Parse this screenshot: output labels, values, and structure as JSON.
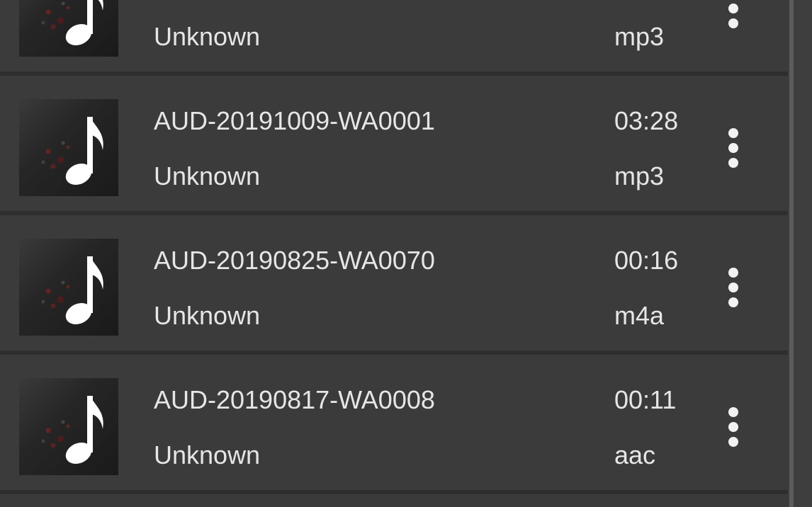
{
  "songs": [
    {
      "title": "",
      "artist": "Unknown",
      "duration": "",
      "format": "mp3",
      "icon": "music-note-icon"
    },
    {
      "title": "AUD-20191009-WA0001",
      "artist": "Unknown",
      "duration": "03:28",
      "format": "mp3",
      "icon": "music-note-icon"
    },
    {
      "title": "AUD-20190825-WA0070",
      "artist": "Unknown",
      "duration": "00:16",
      "format": "m4a",
      "icon": "music-note-icon"
    },
    {
      "title": "AUD-20190817-WA0008",
      "artist": "Unknown",
      "duration": "00:11",
      "format": "aac",
      "icon": "music-note-icon"
    }
  ],
  "row_menu_icon": "more-vert-icon",
  "colors": {
    "background": "#3b3b3b",
    "divider": "#2e2e2e",
    "text": "#e6e6e6"
  }
}
